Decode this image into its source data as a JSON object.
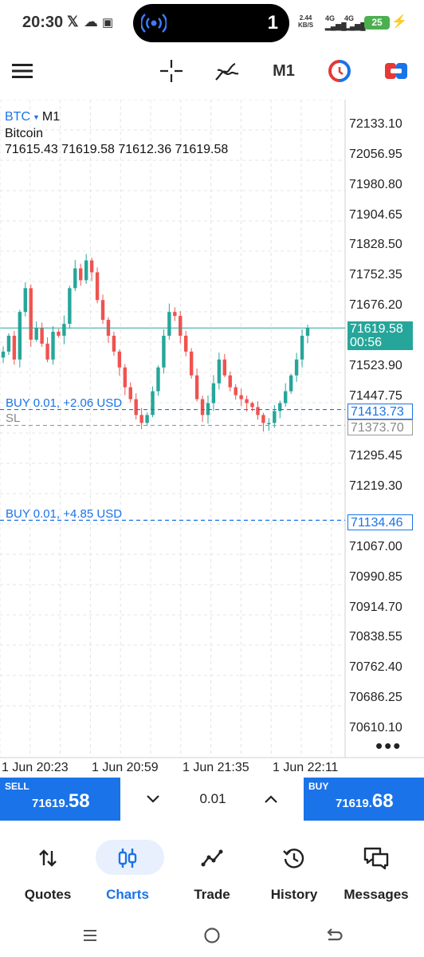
{
  "status_bar": {
    "time": "20:30",
    "notification_count": "1",
    "speed_value": "2.44",
    "speed_unit": "KB/S",
    "net1": "4G",
    "net2": "4G",
    "battery": "25"
  },
  "toolbar": {
    "timeframe": "M1"
  },
  "chart": {
    "symbol": "BTC",
    "timeframe": "M1",
    "name": "Bitcoin",
    "ohlc": "71615.43 71619.58 71612.36 71619.58",
    "price_labels": [
      "72133.10",
      "72056.95",
      "71980.80",
      "71904.65",
      "71828.50",
      "71752.35",
      "71676.20",
      "71523.90",
      "71447.75",
      "71295.45",
      "71219.30",
      "71067.00",
      "70990.85",
      "70914.70",
      "70838.55",
      "70762.40",
      "70686.25",
      "70610.10"
    ],
    "time_labels": [
      "1 Jun 20:23",
      "1 Jun 20:59",
      "1 Jun 21:35",
      "1 Jun 22:11"
    ],
    "current_price": "71619.58",
    "countdown": "00:56",
    "order1_label": "BUY 0.01,  +2.06 USD",
    "order1_price": "71413.73",
    "sl_label": "SL",
    "sl_price": "71373.70",
    "order2_label": "BUY 0.01,  +4.85 USD",
    "order2_price": "71134.46"
  },
  "chart_data": {
    "type": "candlestick",
    "symbol": "BTC",
    "timeframe": "M1",
    "y_range": [
      70610.1,
      72133.1
    ],
    "current_price": 71619.58,
    "horizontal_lines": [
      {
        "label": "BUY 0.01,  +2.06 USD",
        "price": 71413.73
      },
      {
        "label": "SL",
        "price": 71373.7
      },
      {
        "label": "BUY 0.01,  +4.85 USD",
        "price": 71134.46
      }
    ],
    "close_path": [
      71560,
      71600,
      71540,
      71660,
      71720,
      71590,
      71620,
      71580,
      71540,
      71610,
      71600,
      71630,
      71720,
      71770,
      71740,
      71790,
      71760,
      71690,
      71640,
      71600,
      71560,
      71520,
      71470,
      71440,
      71400,
      71380,
      71400,
      71460,
      71520,
      71600,
      71660,
      71650,
      71600,
      71560,
      71500,
      71440,
      71400,
      71430,
      71480,
      71540,
      71500,
      71470,
      71450,
      71440,
      71430,
      71420,
      71400,
      71380,
      71380,
      71410,
      71430,
      71460,
      71500,
      71540,
      71600,
      71619.58
    ]
  },
  "trade_bar": {
    "sell_label": "SELL",
    "sell_price_small": "71619.",
    "sell_price_big": "58",
    "lot": "0.01",
    "buy_label": "BUY",
    "buy_price_small": "71619.",
    "buy_price_big": "68"
  },
  "nav": {
    "items": [
      {
        "label": "Quotes"
      },
      {
        "label": "Charts"
      },
      {
        "label": "Trade"
      },
      {
        "label": "History"
      },
      {
        "label": "Messages"
      }
    ]
  }
}
